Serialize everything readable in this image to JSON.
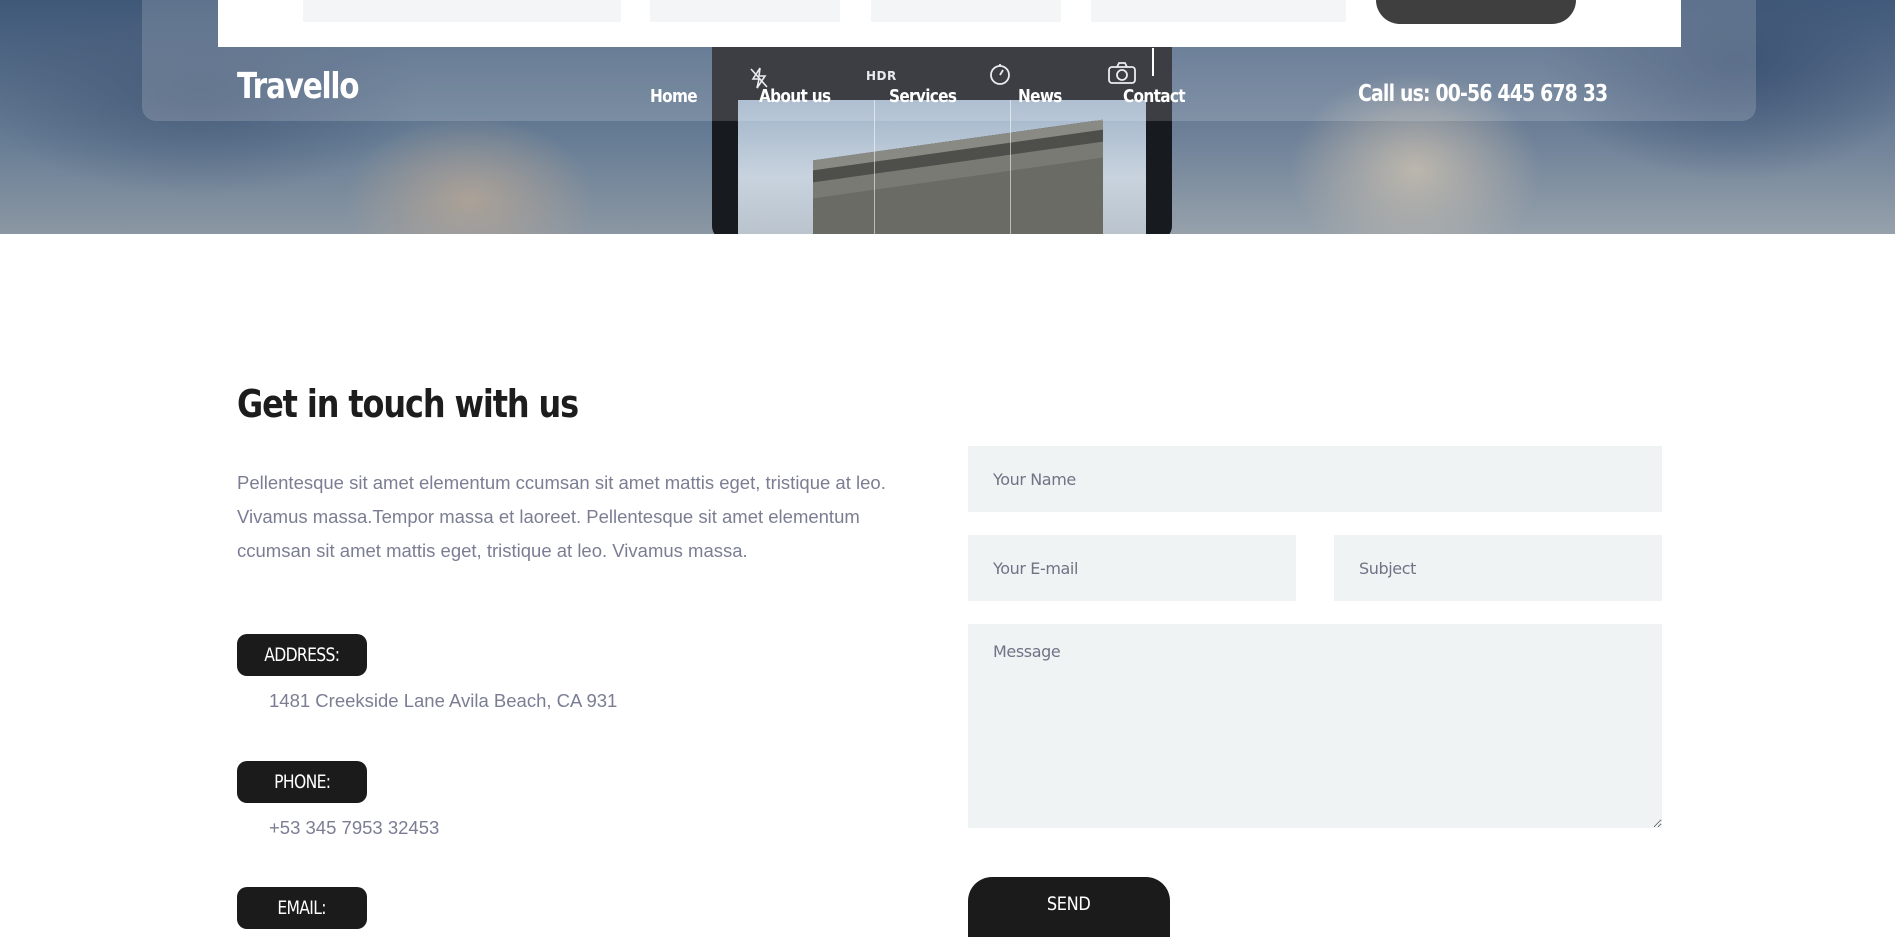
{
  "brand": {
    "logo": "Travello"
  },
  "nav": {
    "items": [
      {
        "label": "Home"
      },
      {
        "label": "About us"
      },
      {
        "label": "Services"
      },
      {
        "label": "News"
      },
      {
        "label": "Contact"
      }
    ]
  },
  "header": {
    "call": "Call us: 00-56 445 678 33"
  },
  "hero_overlay": {
    "hdr": "HDR"
  },
  "contact": {
    "title": "Get in touch with us",
    "intro": "Pellentesque sit amet elementum ccumsan sit amet mattis eget, tristique at leo. Vivamus massa.Tempor massa et laoreet. Pellentesque sit amet elementum ccumsan sit amet mattis eget, tristique at leo. Vivamus massa.",
    "address_label": "ADDRESS:",
    "address_value": "1481 Creekside Lane Avila Beach, CA 931",
    "phone_label": "PHONE:",
    "phone_value": "+53 345 7953 32453",
    "email_label": "EMAIL:"
  },
  "form": {
    "name_placeholder": "Your Name",
    "email_placeholder": "Your E-mail",
    "subject_placeholder": "Subject",
    "message_placeholder": "Message",
    "send_label": "SEND"
  },
  "colors": {
    "accent_dark": "#1b1b1b",
    "field_bg": "#f0f3f4",
    "body_text": "#7b7e93"
  }
}
